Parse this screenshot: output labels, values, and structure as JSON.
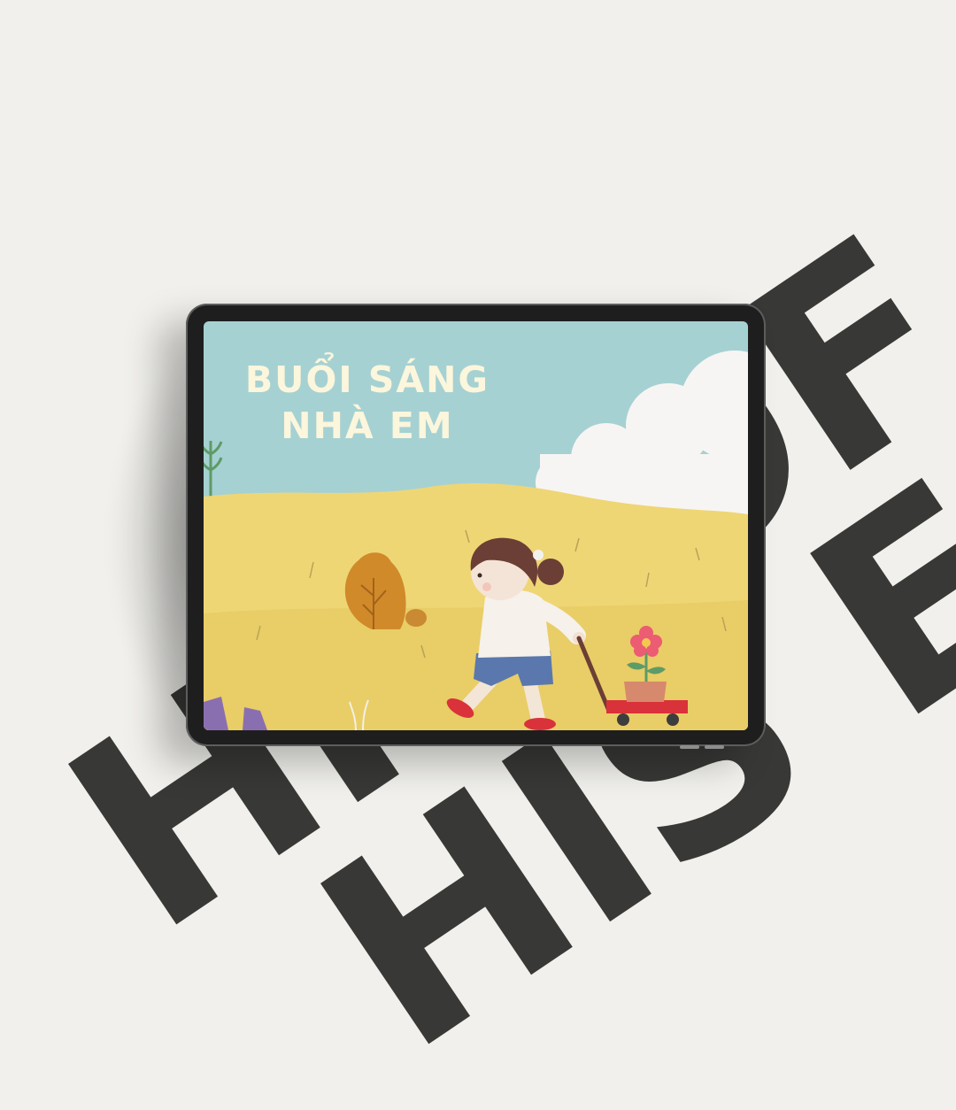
{
  "background_text": {
    "line1": "HIS OF",
    "line2": "HIS E"
  },
  "cover": {
    "title_line1": "BUỔI SÁNG",
    "title_line2": "NHÀ EM"
  },
  "colors": {
    "page_background": "#f1f0ec",
    "background_text": "#383836",
    "tablet_frame": "#1e1e1e",
    "sky": "#a6d1d3",
    "field": "#efd675",
    "cloud": "#f7f5f3",
    "title_text": "#fbf6dc",
    "wagon": "#d9323a"
  }
}
